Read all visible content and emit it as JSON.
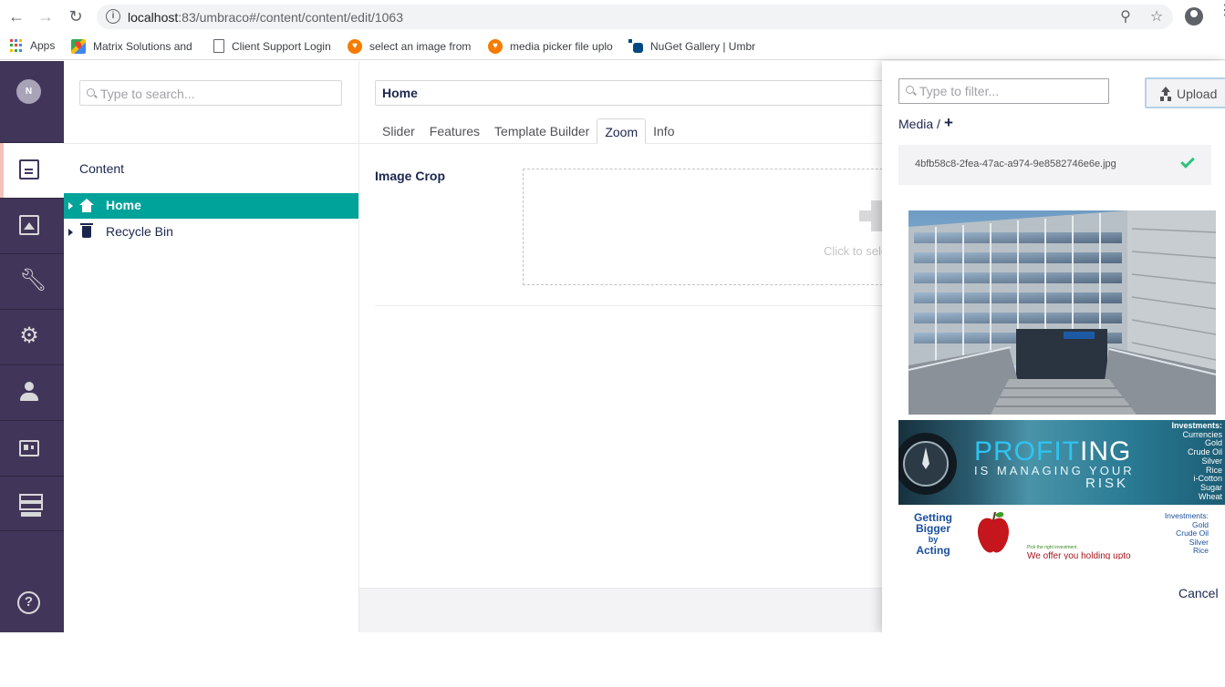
{
  "browser": {
    "url_host": "localhost",
    "url_rest": ":83/umbraco#/content/content/edit/1063",
    "bookmarks": [
      {
        "label": "Apps"
      },
      {
        "label": "Matrix Solutions and"
      },
      {
        "label": "Client Support Login"
      },
      {
        "label": "select an image from"
      },
      {
        "label": "media picker file uplo"
      },
      {
        "label": "NuGet Gallery | Umbr"
      }
    ]
  },
  "user": {
    "initial": "N"
  },
  "sections": [
    {
      "name": "content",
      "icon": "document-icon",
      "active": true
    },
    {
      "name": "media",
      "icon": "image-icon"
    },
    {
      "name": "settings",
      "icon": "wrench-icon"
    },
    {
      "name": "developer",
      "icon": "gear-icon"
    },
    {
      "name": "users",
      "icon": "user-icon"
    },
    {
      "name": "members",
      "icon": "id-card-icon"
    },
    {
      "name": "forms",
      "icon": "forms-icon"
    }
  ],
  "tree": {
    "search_placeholder": "Type to search...",
    "root_label": "Content",
    "nodes": [
      {
        "label": "Home",
        "icon": "home-icon",
        "selected": true
      },
      {
        "label": "Recycle Bin",
        "icon": "trash-icon",
        "selected": false
      }
    ]
  },
  "editor": {
    "name_value": "Home",
    "tabs": [
      {
        "label": "Slider"
      },
      {
        "label": "Features"
      },
      {
        "label": "Template Builder"
      },
      {
        "label": "Zoom",
        "active": true
      },
      {
        "label": "Info"
      }
    ],
    "property_label": "Image Crop",
    "drop_text": "Click to sele"
  },
  "media_picker": {
    "filter_placeholder": "Type to filter...",
    "upload_label": "Upload",
    "breadcrumb": "Media /",
    "breadcrumb_add": "+",
    "selected_filename": "4bfb58c8-2fea-47ac-a974-9e8582746e6e.jpg",
    "banner1": {
      "headline_a": "PROFIT",
      "headline_b": "ING",
      "subline1": "IS MANAGING YOUR",
      "subline2": "RISK",
      "list_title": "Investments:",
      "items": [
        "Currencies",
        "Gold",
        "Crude Oil",
        "Silver",
        "Rice",
        "i-Cotton",
        "Sugar",
        "Wheat"
      ]
    },
    "banner2": {
      "slogan": [
        "Getting",
        "Bigger",
        "by",
        "Acting"
      ],
      "tagline_small": "Pick the right investment.",
      "tagline": "We offer you holding upto",
      "list_title": "Investments:",
      "items": [
        "Gold",
        "Crude Oil",
        "Silver",
        "Rice"
      ]
    },
    "cancel_label": "Cancel"
  }
}
